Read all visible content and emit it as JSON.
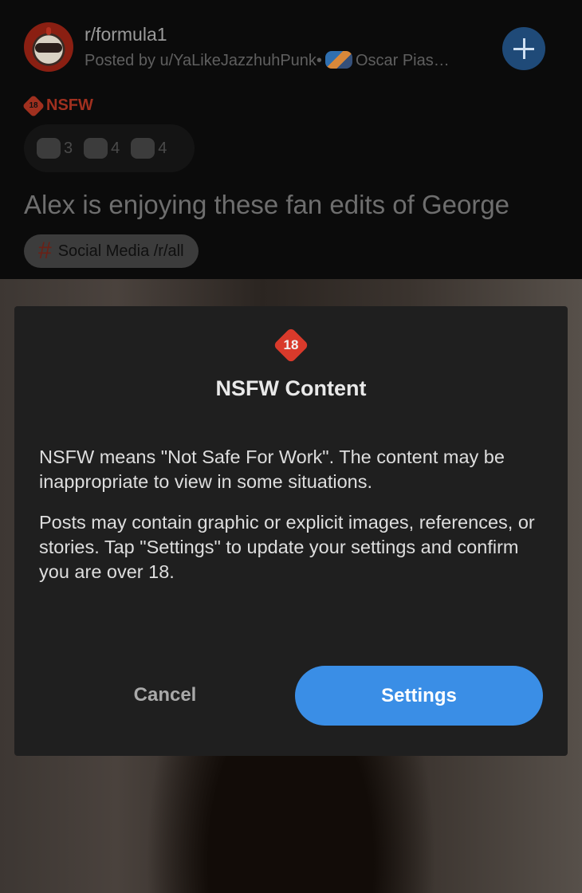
{
  "post": {
    "subreddit": "r/formula1",
    "posted_by": "Posted by u/YaLikeJazzhuhPunk•",
    "user_flair": "Oscar Pias…",
    "nsfw_tag": "NSFW",
    "nsfw_badge_number": "18",
    "awards": [
      {
        "icon": "award-icon",
        "count": "3"
      },
      {
        "icon": "award-icon",
        "count": "4"
      },
      {
        "icon": "award-icon",
        "count": "4"
      }
    ],
    "title": "Alex is enjoying these fan edits of George",
    "flair": {
      "icon": "#",
      "text": "Social Media /r/all"
    }
  },
  "dialog": {
    "badge": "18",
    "title": "NSFW Content",
    "paragraph1": "NSFW means \"Not Safe For Work\". The content may be inappropriate to view in some situations.",
    "paragraph2": "Posts may contain graphic or explicit images, references, or stories. Tap \"Settings\" to update your settings and confirm you are over 18.",
    "cancel_label": "Cancel",
    "settings_label": "Settings"
  },
  "colors": {
    "accent": "#3a8ee6",
    "nsfw_red": "#d93a2b",
    "dialog_bg": "#1f1f1f"
  }
}
